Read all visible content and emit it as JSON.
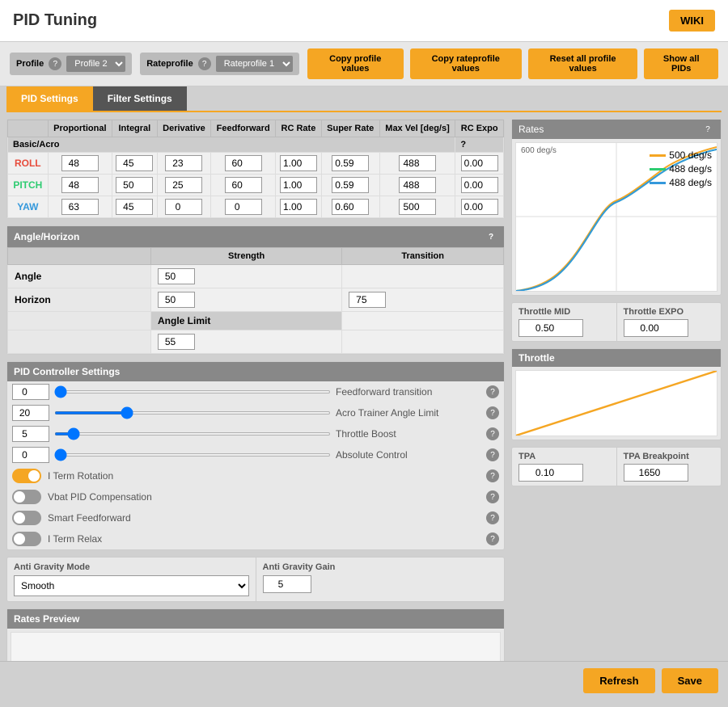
{
  "title": "PID Tuning",
  "wiki": "WIKI",
  "profile": {
    "label": "Profile",
    "help": "?",
    "options": [
      "Profile 2"
    ],
    "selected": "Profile 2"
  },
  "rateprofile": {
    "label": "Rateprofile",
    "help": "?",
    "options": [
      "Rateprofile 1"
    ],
    "selected": "Rateprofile 1"
  },
  "buttons": {
    "copy_profile": "Copy profile values",
    "copy_rateprofile": "Copy rateprofile values",
    "reset_profile": "Reset all profile values",
    "show_pids": "Show all PIDs"
  },
  "tabs": {
    "pid_settings": "PID Settings",
    "filter_settings": "Filter Settings"
  },
  "pid_table": {
    "headers": [
      "",
      "Proportional",
      "Integral",
      "Derivative",
      "Feedforward",
      "RC Rate",
      "Super Rate",
      "Max Vel\n[deg/s]",
      "RC Expo"
    ],
    "section_label": "Basic/Acro",
    "rows": [
      {
        "name": "ROLL",
        "color": "roll",
        "p": 48,
        "i": 45,
        "d": 23,
        "ff": 60,
        "rc_rate": 1.0,
        "super_rate": 0.59,
        "max_vel": 488,
        "rc_expo": 0.0
      },
      {
        "name": "PITCH",
        "color": "pitch",
        "p": 48,
        "i": 50,
        "d": 25,
        "ff": 60,
        "rc_rate": 1.0,
        "super_rate": 0.59,
        "max_vel": 488,
        "rc_expo": 0.0
      },
      {
        "name": "YAW",
        "color": "yaw",
        "p": 63,
        "i": 45,
        "d": 0,
        "ff": 0,
        "rc_rate": 1.0,
        "super_rate": 0.6,
        "max_vel": 500,
        "rc_expo": 0.0
      }
    ]
  },
  "angle_horizon": {
    "title": "Angle/Horizon",
    "strength_label": "Strength",
    "transition_label": "Transition",
    "angle_label": "Angle",
    "horizon_label": "Horizon",
    "angle_strength": 50,
    "horizon_strength": 50,
    "horizon_transition": 75,
    "angle_limit_label": "Angle Limit",
    "angle_limit": 55
  },
  "pid_controller": {
    "title": "PID Controller Settings",
    "sliders": [
      {
        "label": "Feedforward transition",
        "value": 0,
        "min": 0,
        "max": 100
      },
      {
        "label": "Acro Trainer Angle Limit",
        "value": 20,
        "min": 0,
        "max": 80
      },
      {
        "label": "Throttle Boost",
        "value": 5,
        "min": 0,
        "max": 100
      },
      {
        "label": "Absolute Control",
        "value": 0,
        "min": 0,
        "max": 20
      }
    ],
    "toggles": [
      {
        "label": "I Term Rotation",
        "on": true
      },
      {
        "label": "Vbat PID Compensation",
        "on": false
      },
      {
        "label": "Smart Feedforward",
        "on": false
      },
      {
        "label": "I Term Relax",
        "on": false
      }
    ]
  },
  "anti_gravity": {
    "mode_label": "Anti Gravity Mode",
    "gain_label": "Anti Gravity Gain",
    "mode": "Smooth",
    "gain": 5
  },
  "rates_preview": {
    "title": "Rates Preview"
  },
  "rates_chart": {
    "title": "Rates",
    "max_label": "600 deg/s",
    "legend": [
      {
        "color": "#f5a623",
        "label": "500 deg/s"
      },
      {
        "color": "#2ecc71",
        "label": "488 deg/s"
      },
      {
        "color": "#3498db",
        "label": "488 deg/s"
      }
    ]
  },
  "throttle_mid": {
    "label": "Throttle MID",
    "value": "0.50"
  },
  "throttle_expo": {
    "label": "Throttle EXPO",
    "value": "0.00"
  },
  "throttle_chart": {
    "title": "Throttle"
  },
  "tpa": {
    "label": "TPA",
    "value": "0.10"
  },
  "tpa_breakpoint": {
    "label": "TPA Breakpoint",
    "value": "1650"
  },
  "footer": {
    "refresh": "Refresh",
    "save": "Save"
  }
}
